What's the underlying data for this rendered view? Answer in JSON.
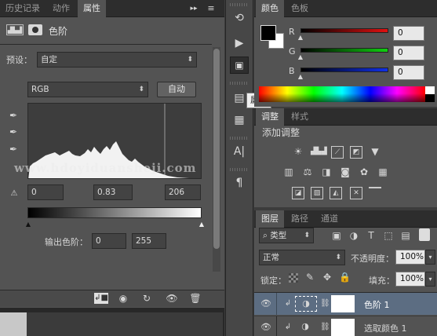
{
  "left_panel": {
    "tabs": [
      "历史记录",
      "动作",
      "属性"
    ],
    "active_tab": 2,
    "header_title": "色阶",
    "preset_label": "预设：",
    "preset_value": "自定",
    "channel_value": "RGB",
    "auto_button": "自动",
    "input_black": "0",
    "input_gamma": "0.83",
    "input_white": "206",
    "output_label": "输出色阶：",
    "output_black": "0",
    "output_white": "255",
    "watermark": "www.hdoyiduansheji.com"
  },
  "tooltip": "属性",
  "color_panel": {
    "tabs": [
      "颜色",
      "色板"
    ],
    "channels": [
      {
        "label": "R",
        "value": "0",
        "color": "#d22020"
      },
      {
        "label": "G",
        "value": "0",
        "color": "#22b022"
      },
      {
        "label": "B",
        "value": "0",
        "color": "#2040d8"
      }
    ]
  },
  "adjust_panel": {
    "tabs": [
      "调整",
      "样式"
    ],
    "title": "添加调整"
  },
  "layers_panel": {
    "tabs": [
      "图层",
      "路径",
      "通道"
    ],
    "kind_label": "类型",
    "blend_mode": "正常",
    "opacity_label": "不透明度：",
    "opacity_value": "100%",
    "lock_label": "锁定：",
    "fill_label": "填充：",
    "fill_value": "100%",
    "layers": [
      {
        "name": "色阶 1",
        "selected": true
      },
      {
        "name": "选取颜色 1",
        "selected": false
      }
    ]
  }
}
